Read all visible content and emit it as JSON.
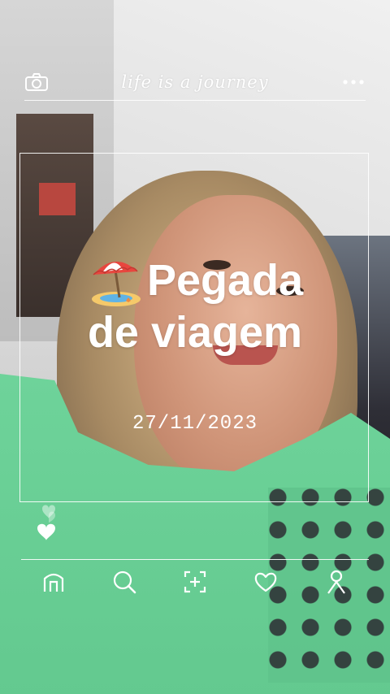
{
  "header": {
    "tagline": "life is a journey",
    "camera_icon": "camera-icon",
    "more_icon": "more-dots-icon"
  },
  "card": {
    "title_line1": "Pegada",
    "title_line2": "de viagem",
    "emoji": "beach-umbrella",
    "date": "27/11/2023"
  },
  "nav": {
    "items": [
      {
        "icon": "home-icon"
      },
      {
        "icon": "search-icon"
      },
      {
        "icon": "add-frame-icon"
      },
      {
        "icon": "heart-icon"
      },
      {
        "icon": "profile-icon"
      }
    ]
  },
  "colors": {
    "overlay": "#ffffff",
    "shirt": "#6ed39a"
  }
}
